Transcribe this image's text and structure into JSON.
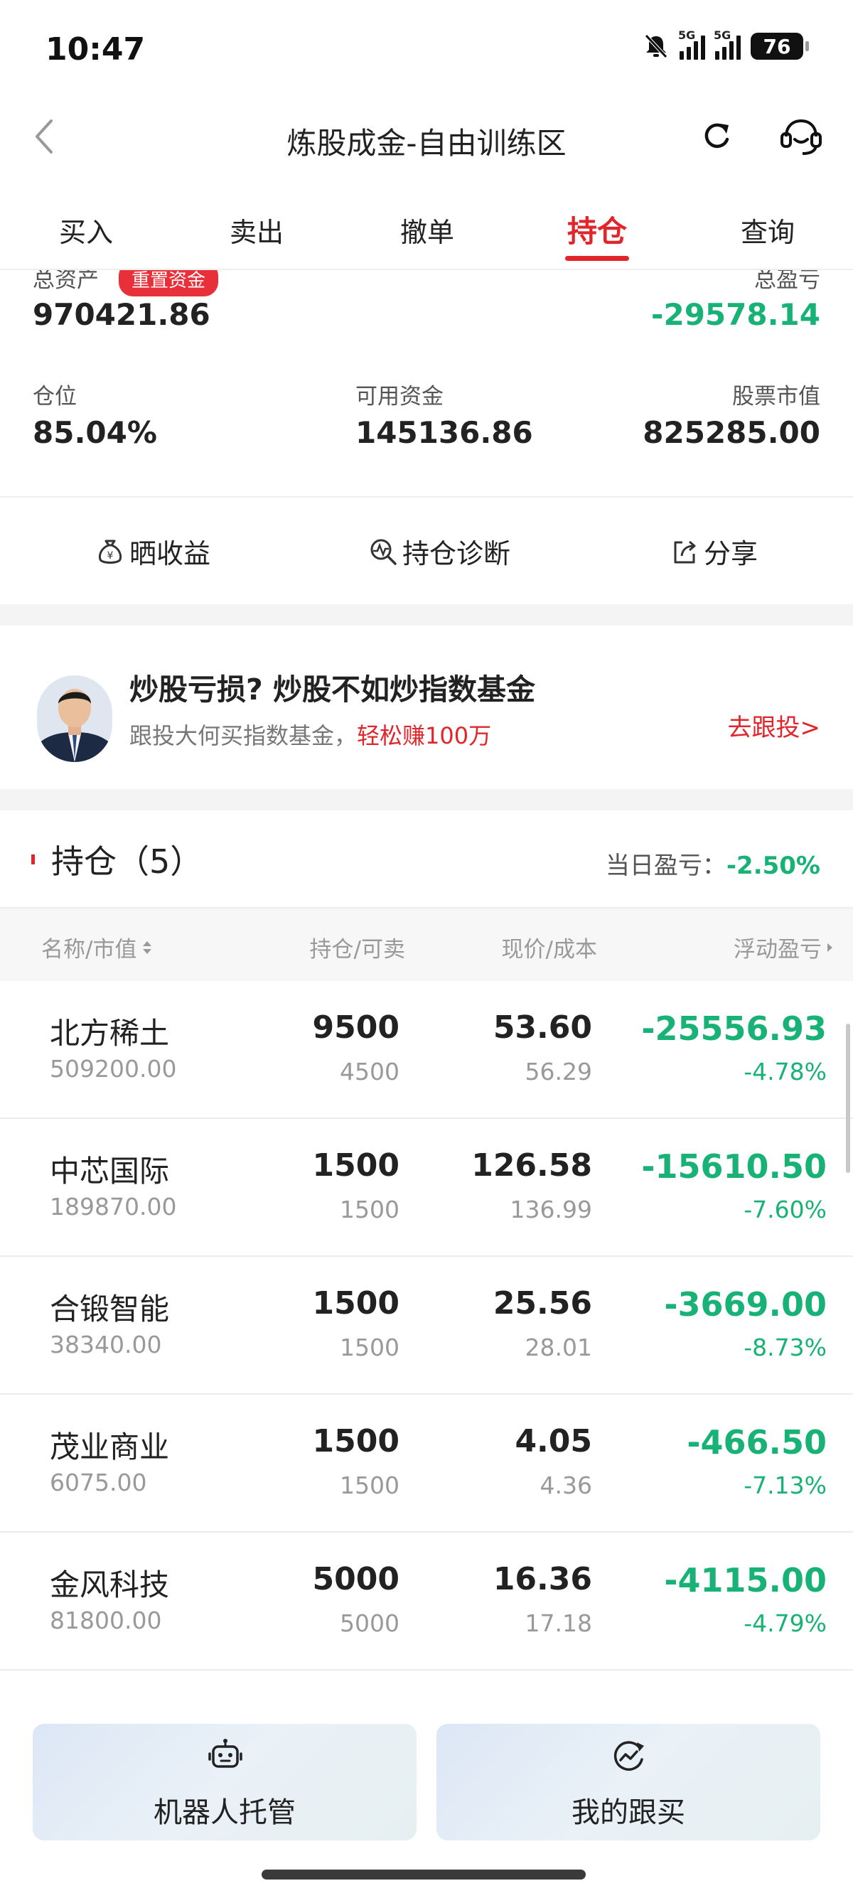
{
  "status_bar": {
    "time": "10:47",
    "net1": "5G",
    "net2": "5G",
    "battery": "76"
  },
  "header": {
    "title": "炼股成金-自由训练区",
    "icons": [
      "back-icon",
      "refresh-icon",
      "customer-service-icon"
    ]
  },
  "tabs": [
    "买入",
    "卖出",
    "撤单",
    "持仓",
    "查询"
  ],
  "active_tab": "持仓",
  "summary": {
    "total_assets_label": "总资产",
    "reset_label": "重置资金",
    "total_assets": "970421.86",
    "total_pl_label": "总盈亏",
    "total_pl": "-29578.14",
    "position_label": "仓位",
    "position": "85.04%",
    "available_label": "可用资金",
    "available": "145136.86",
    "market_value_label": "股票市值",
    "market_value": "825285.00"
  },
  "actions": {
    "show_profit": "晒收益",
    "diagnose": "持仓诊断",
    "share": "分享"
  },
  "promo": {
    "title": "炒股亏损? 炒股不如炒指数基金",
    "subtitle": "跟投大何买指数基金，",
    "highlight": "轻松赚100万",
    "link": "去跟投>"
  },
  "holdings": {
    "title": "持仓（5）",
    "daily_label": "当日盈亏：",
    "daily_value": "-2.50%",
    "columns": {
      "name": "名称/市值",
      "qty": "持仓/可卖",
      "price": "现价/成本",
      "pl": "浮动盈亏"
    },
    "rows": [
      {
        "name": "北方稀土",
        "mv": "509200.00",
        "qty": "9500",
        "avail": "4500",
        "price": "53.60",
        "cost": "56.29",
        "pl": "-25556.93",
        "pct": "-4.78%"
      },
      {
        "name": "中芯国际",
        "mv": "189870.00",
        "qty": "1500",
        "avail": "1500",
        "price": "126.58",
        "cost": "136.99",
        "pl": "-15610.50",
        "pct": "-7.60%"
      },
      {
        "name": "合锻智能",
        "mv": "38340.00",
        "qty": "1500",
        "avail": "1500",
        "price": "25.56",
        "cost": "28.01",
        "pl": "-3669.00",
        "pct": "-8.73%"
      },
      {
        "name": "茂业商业",
        "mv": "6075.00",
        "qty": "1500",
        "avail": "1500",
        "price": "4.05",
        "cost": "4.36",
        "pl": "-466.50",
        "pct": "-7.13%"
      },
      {
        "name": "金风科技",
        "mv": "81800.00",
        "qty": "5000",
        "avail": "5000",
        "price": "16.36",
        "cost": "17.18",
        "pl": "-4115.00",
        "pct": "-4.79%"
      }
    ]
  },
  "bottom": {
    "robot": "机器人托管",
    "follow": "我的跟买"
  },
  "colors": {
    "accent_red": "#e0252b",
    "loss_green": "#18b277"
  }
}
